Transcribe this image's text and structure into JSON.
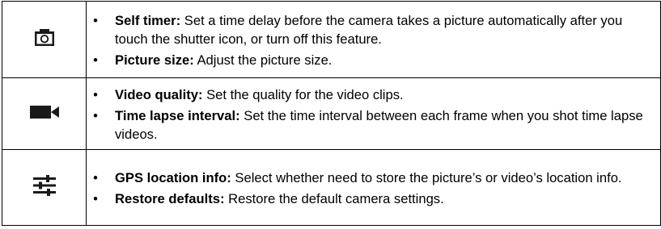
{
  "rows": [
    {
      "icon": "camera-icon",
      "items": [
        {
          "term": "Self timer:",
          "text": " Set a time delay before the camera takes a picture automatically after you touch the shutter icon, or turn off this feature."
        },
        {
          "term": "Picture size:",
          "text": " Adjust the picture size."
        }
      ]
    },
    {
      "icon": "video-camera-icon",
      "items": [
        {
          "term": "Video quality:",
          "text": " Set the quality for the video clips."
        },
        {
          "term": "Time lapse interval:",
          "text": " Set the time interval between each frame when you shot time lapse videos."
        }
      ]
    },
    {
      "icon": "settings-sliders-icon",
      "items": [
        {
          "term": "GPS location info:",
          "text": " Select whether need to store the picture’s or video’s location info."
        },
        {
          "term": "Restore defaults:",
          "text": " Restore the default camera settings."
        }
      ]
    }
  ],
  "bullet_glyph": "•",
  "colors": {
    "text": "#000000",
    "border": "#000000",
    "icon": "#1a1a1a"
  }
}
